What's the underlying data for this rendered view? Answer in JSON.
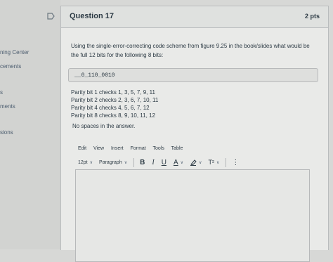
{
  "sidebar": {
    "items": [
      {
        "label": "ning Center"
      },
      {
        "label": "cements"
      },
      {
        "label": "s"
      },
      {
        "label": "ments"
      },
      {
        "label": "sions"
      }
    ]
  },
  "question": {
    "title": "Question 17",
    "points": "2 pts",
    "text": "Using the single-error-correcting code scheme from figure 9.25 in the book/slides what would be the full 12 bits for the following 8 bits:",
    "bits": "__0_110_0010",
    "parity": [
      "Parity bit 1 checks 1, 3, 5, 7, 9, 11",
      "Parity bit 2 checks 2, 3, 6, 7, 10, 11",
      "Parity bit 4 checks 4, 5, 6, 7, 12",
      "Parity bit 8 checks 8, 9, 10, 11, 12"
    ],
    "note": "No spaces in the answer."
  },
  "editor": {
    "menu": [
      "Edit",
      "View",
      "Insert",
      "Format",
      "Tools",
      "Table"
    ],
    "font_size": "12pt",
    "block_format": "Paragraph",
    "bold": "B",
    "italic": "I",
    "underline": "U",
    "text_color": "A",
    "superscript": "T²",
    "more": "⋮"
  },
  "colors": {
    "page_bg": "#d7d8d6",
    "card_bg": "#e9eae8",
    "text": "#2d3b45"
  }
}
